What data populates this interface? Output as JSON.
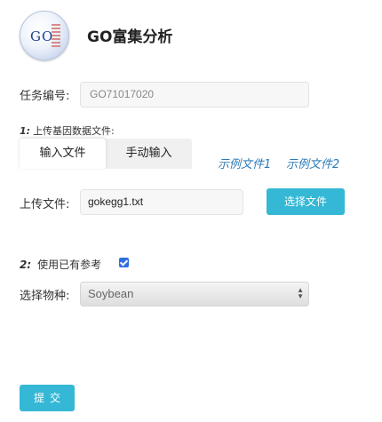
{
  "app": {
    "title": "GO富集分析",
    "logo_text": "GO"
  },
  "task": {
    "label": "任务编号:",
    "value": "GO71017020"
  },
  "step1": {
    "number": "1:",
    "label": "上传基因数据文件:"
  },
  "tabs": [
    {
      "label": "输入文件",
      "active": true
    },
    {
      "label": "手动输入",
      "active": false
    }
  ],
  "examples": [
    "示例文件1",
    "示例文件2"
  ],
  "upload": {
    "label": "上传文件:",
    "value": "gokegg1.txt",
    "button_label": "选择文件"
  },
  "step2": {
    "number": "2:",
    "label": "使用已有参考",
    "checked": true
  },
  "species": {
    "label": "选择物种:",
    "selected": "Soybean"
  },
  "submit": {
    "label": "提交"
  },
  "colors": {
    "accent": "#35b8d5",
    "link": "#2a7ab8",
    "checkbox": "#2f6fe0"
  }
}
